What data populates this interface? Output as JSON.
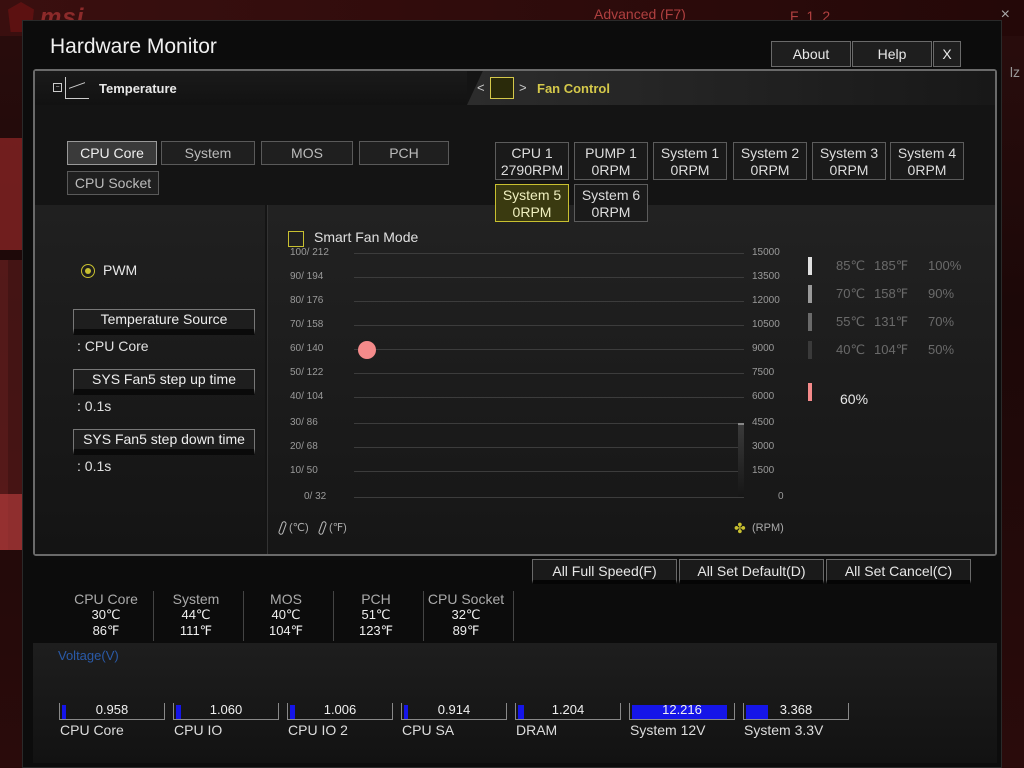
{
  "background": {
    "brand": "msi",
    "advanced_label": "Advanced (F7)",
    "icons": "F12",
    "close": "×",
    "side_text": "lz"
  },
  "dialog": {
    "title": "Hardware Monitor",
    "about": "About",
    "help": "Help",
    "close": "X"
  },
  "temperature": {
    "header": "Temperature",
    "sources": [
      "CPU Core",
      "System",
      "MOS",
      "PCH",
      "CPU Socket"
    ],
    "selected": "CPU Core"
  },
  "fan_control": {
    "header": "Fan Control",
    "left_arrow": "<",
    "right_arrow": ">",
    "fans": [
      {
        "name": "CPU 1",
        "rpm": "2790RPM"
      },
      {
        "name": "PUMP 1",
        "rpm": "0RPM"
      },
      {
        "name": "System 1",
        "rpm": "0RPM"
      },
      {
        "name": "System 2",
        "rpm": "0RPM"
      },
      {
        "name": "System 3",
        "rpm": "0RPM"
      },
      {
        "name": "System 4",
        "rpm": "0RPM"
      },
      {
        "name": "System 5",
        "rpm": "0RPM"
      },
      {
        "name": "System 6",
        "rpm": "0RPM"
      }
    ],
    "selected": "System 5"
  },
  "fan_settings": {
    "mode_label": "PWM",
    "temp_source_label": "Temperature Source",
    "temp_source_value": ": CPU Core",
    "step_up_label": "SYS Fan5 step up time",
    "step_up_value": ": 0.1s",
    "step_down_label": "SYS Fan5 step down time",
    "step_down_value": ": 0.1s",
    "smart_fan_label": "Smart Fan Mode"
  },
  "graph": {
    "y_labels_left": [
      "100/ 212",
      "90/ 194",
      "80/ 176",
      "70/ 158",
      "60/ 140",
      "50/ 122",
      "40/ 104",
      "30/  86",
      "20/  68",
      "10/  50",
      "0/  32"
    ],
    "y_labels_right": [
      "15000",
      "13500",
      "12000",
      "10500",
      "9000",
      "7500",
      "6000",
      "4500",
      "3000",
      "1500",
      "0"
    ],
    "point_temp_c": 60,
    "unit_c": "(℃)",
    "unit_f": "(℉)",
    "unit_rpm": "(RPM)",
    "legend": [
      {
        "c": "85℃",
        "f": "185℉",
        "pct": "100%",
        "color": "#e0e0e0"
      },
      {
        "c": "70℃",
        "f": "158℉",
        "pct": "90%",
        "color": "#9a9a9a"
      },
      {
        "c": "55℃",
        "f": "131℉",
        "pct": "70%",
        "color": "#6a6a6a"
      },
      {
        "c": "40℃",
        "f": "104℉",
        "pct": "50%",
        "color": "#3a3a3a"
      }
    ],
    "current_pct": "60%",
    "current_color": "#f48a8a"
  },
  "actions": {
    "full_speed": "All Full Speed(F)",
    "set_default": "All Set Default(D)",
    "set_cancel": "All Set Cancel(C)"
  },
  "readings": [
    {
      "name": "CPU Core",
      "c": "30℃",
      "f": "86℉"
    },
    {
      "name": "System",
      "c": "44℃",
      "f": "111℉"
    },
    {
      "name": "MOS",
      "c": "40℃",
      "f": "104℉"
    },
    {
      "name": "PCH",
      "c": "51℃",
      "f": "123℉"
    },
    {
      "name": "CPU Socket",
      "c": "32℃",
      "f": "89℉"
    }
  ],
  "voltage": {
    "title": "Voltage(V)",
    "items": [
      {
        "name": "CPU Core",
        "value": "0.958",
        "level": 0.04
      },
      {
        "name": "CPU IO",
        "value": "1.060",
        "level": 0.05
      },
      {
        "name": "CPU IO 2",
        "value": "1.006",
        "level": 0.05
      },
      {
        "name": "CPU SA",
        "value": "0.914",
        "level": 0.04
      },
      {
        "name": "DRAM",
        "value": "1.204",
        "level": 0.06
      },
      {
        "name": "System 12V",
        "value": "12.216",
        "level": 0.95
      },
      {
        "name": "System 3.3V",
        "value": "3.368",
        "level": 0.22
      }
    ],
    "bar_color": "#1515e8"
  }
}
